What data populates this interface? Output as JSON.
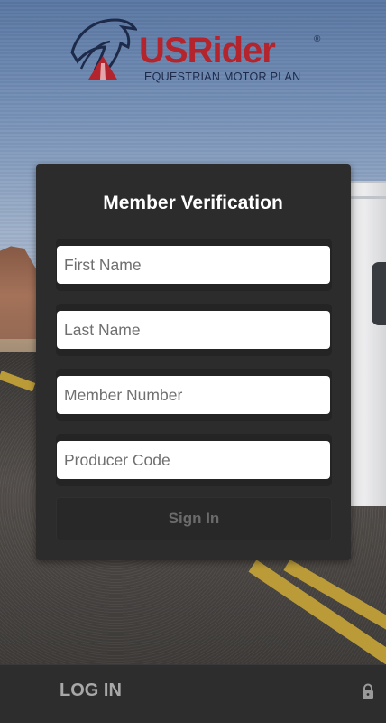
{
  "logo": {
    "brand_us": "US",
    "brand_rider": "Rider",
    "registered": "®",
    "tagline": "EQUESTRIAN MOTOR PLAN"
  },
  "form": {
    "title": "Member Verification",
    "first_name_placeholder": "First Name",
    "last_name_placeholder": "Last Name",
    "member_number_placeholder": "Member Number",
    "producer_code_placeholder": "Producer Code",
    "sign_in_label": "Sign In"
  },
  "bottom_bar": {
    "label": "LOG IN",
    "icon": "lock-icon"
  },
  "colors": {
    "brand_red": "#b3242d",
    "brand_navy": "#1d2a4a",
    "card_bg": "#2c2c2c",
    "bar_bg": "#2d2d2d"
  }
}
